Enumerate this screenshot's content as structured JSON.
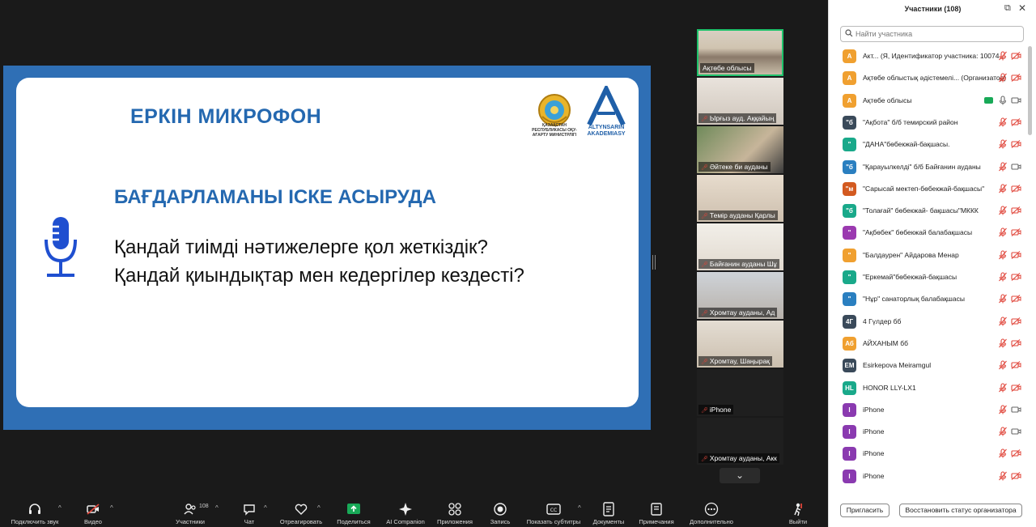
{
  "slide": {
    "title": "ЕРКІН МИКРОФОН",
    "subtitle": "БАҒДАРЛАМАНЫ ІСКЕ АСЫРУДА",
    "question1": "Қандай тиімді нәтижелерге қол жеткіздік?",
    "question2": "Қандай қиындықтар мен кедергілер кездесті?",
    "emblem_caption": "ҚАЗАҚСТАН РЕСПУБЛИКАСЫ ОҚУ-АҒАРТУ МИНИСТРЛІГІ",
    "academy_caption": "ALTYNSARIN AKADEMIASY"
  },
  "video_strip": [
    {
      "name": "Ақтөбе облысы",
      "muted": false
    },
    {
      "name": "Ырғыз ауд. Аққайың",
      "muted": true
    },
    {
      "name": "Әйтеке би ауданы",
      "muted": true
    },
    {
      "name": "Темір ауданы Қарлы",
      "muted": true
    },
    {
      "name": "Байғанин ауданы Шұ",
      "muted": true
    },
    {
      "name": "Хромтау ауданы, Ад",
      "muted": true
    },
    {
      "name": "Хромтау, Шаңырақ",
      "muted": true
    },
    {
      "name": "iPhone",
      "muted": true
    },
    {
      "name": "Хромтау ауданы, Акк",
      "muted": true
    }
  ],
  "panel": {
    "title": "Участники (108)",
    "search_placeholder": "Найти участника",
    "invite_label": "Пригласить",
    "restore_label": "Восстановить статус организатора",
    "participants": [
      {
        "initials": "А",
        "color": "#f0a030",
        "name": "Акт...   (Я, Идентификатор участника: 1007423)",
        "mic": "muted",
        "cam": "off"
      },
      {
        "initials": "А",
        "color": "#f0a030",
        "name": "Ақтөбе облыстық әдістемелі... (Организатор)",
        "mic": "muted",
        "cam": "off"
      },
      {
        "initials": "А",
        "color": "#f0a030",
        "name": "Ақтөбе облысы",
        "mic": "on",
        "cam": "on",
        "sharing": true
      },
      {
        "initials": "\"б",
        "color": "#3a4a5a",
        "name": "\"Ақбота\" б/б темирский район",
        "mic": "muted",
        "cam": "off"
      },
      {
        "initials": "\"",
        "color": "#19a98a",
        "name": "\"ДАНА\"бөбекжай-бақшасы.",
        "mic": "muted",
        "cam": "off"
      },
      {
        "initials": "\"б",
        "color": "#2a7fc0",
        "name": "\"Қарауылкелді\" б/б Байғанин ауданы",
        "mic": "muted",
        "cam": "on"
      },
      {
        "initials": "\"м",
        "color": "#d35a20",
        "name": "\"Сарысай мектеп-бөбекжай-бақшасы\"",
        "mic": "muted",
        "cam": "off"
      },
      {
        "initials": "\"б",
        "color": "#19a98a",
        "name": "\"Толағай\" бөбекжай- бақшасы\"МККК",
        "mic": "muted",
        "cam": "off"
      },
      {
        "initials": "\"",
        "color": "#9b3ab0",
        "name": "\"Ақбөбек\" бөбекжай балабақшасы",
        "mic": "muted",
        "cam": "off"
      },
      {
        "initials": "\"",
        "color": "#f0a030",
        "name": "\"Балдаурен\" Айдарова Менар",
        "mic": "muted",
        "cam": "off"
      },
      {
        "initials": "\"",
        "color": "#19a98a",
        "name": "\"Еркемай\"бөбекжай-бақшасы",
        "mic": "muted",
        "cam": "off"
      },
      {
        "initials": "\"",
        "color": "#2a7fc0",
        "name": "\"Нұр\" санаторлық балабақшасы",
        "mic": "muted",
        "cam": "off"
      },
      {
        "initials": "4Г",
        "color": "#3a4a5a",
        "name": "4 Гүлдер бб",
        "mic": "muted",
        "cam": "off"
      },
      {
        "initials": "Аб",
        "color": "#f0a030",
        "name": "АЙХАНЫМ бб",
        "mic": "muted",
        "cam": "off"
      },
      {
        "initials": "ЕМ",
        "color": "#3a4a5a",
        "name": "Esirkepova Meiramgul",
        "mic": "muted",
        "cam": "off"
      },
      {
        "initials": "HL",
        "color": "#19a98a",
        "name": "HONOR LLY-LX1",
        "mic": "muted",
        "cam": "off"
      },
      {
        "initials": "I",
        "color": "#8a3ab0",
        "name": "iPhone",
        "mic": "muted",
        "cam": "on"
      },
      {
        "initials": "I",
        "color": "#8a3ab0",
        "name": "iPhone",
        "mic": "muted",
        "cam": "on"
      },
      {
        "initials": "I",
        "color": "#8a3ab0",
        "name": "iPhone",
        "mic": "muted",
        "cam": "off"
      },
      {
        "initials": "I",
        "color": "#8a3ab0",
        "name": "iPhone",
        "mic": "muted",
        "cam": "off"
      }
    ]
  },
  "toolbar": {
    "audio": "Подключить звук",
    "video": "Видео",
    "participants": "Участники",
    "participants_count": "108",
    "chat": "Чат",
    "react": "Отреагировать",
    "share": "Поделиться",
    "ai": "AI Companion",
    "apps": "Приложения",
    "record": "Запись",
    "captions": "Показать субтитры",
    "docs": "Документы",
    "notes": "Примечания",
    "more": "Дополнительно",
    "leave": "Выйти"
  },
  "colors": {
    "slide_blue": "#2f6fb5",
    "heading_blue": "#2468b0",
    "active_speaker": "#1ec26b",
    "muted_red": "#e0453a"
  }
}
